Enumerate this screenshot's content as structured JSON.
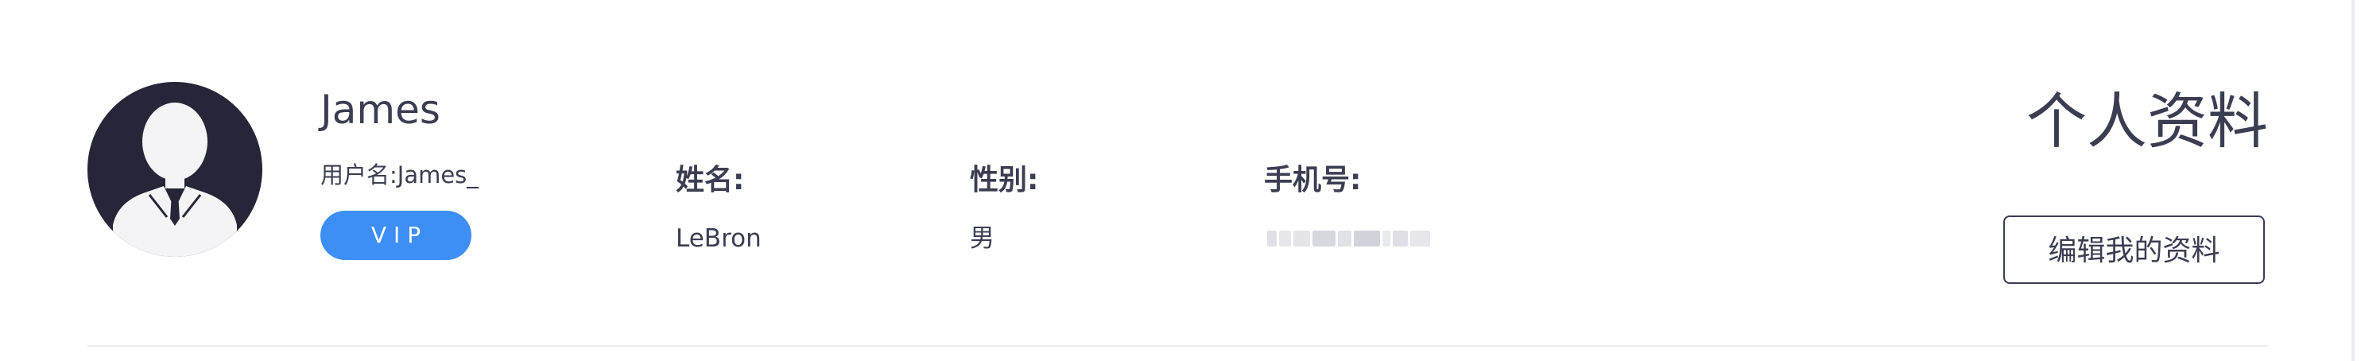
{
  "profile": {
    "display_name": "James",
    "account_label": "用户名:James_",
    "badge": "VIP"
  },
  "fields": {
    "name_label": "姓名:",
    "name_value": "LeBron",
    "gender_label": "性别:",
    "gender_value": "男",
    "phone_label": "手机号:"
  },
  "header": {
    "title": "个人资料",
    "edit_button": "编辑我的资料"
  },
  "icons": {
    "avatar": "user-silhouette-icon"
  },
  "colors": {
    "text": "#3b3d52",
    "accent": "#3d8ef5",
    "avatar_bg": "#262638",
    "divider": "#ececf0"
  }
}
